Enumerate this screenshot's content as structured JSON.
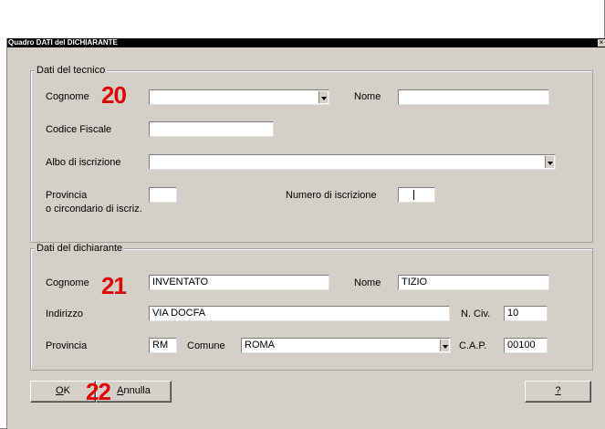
{
  "window": {
    "title": "Quadro DATI del DICHIARANTE",
    "close": "×"
  },
  "tecnico": {
    "legend": "Dati del tecnico",
    "cognome_label": "Cognome",
    "cognome_value": "",
    "nome_label": "Nome",
    "nome_value": "",
    "codice_fiscale_label": "Codice Fiscale",
    "codice_fiscale_value": "",
    "albo_label": "Albo di iscrizione",
    "albo_value": "",
    "provincia_label": "Provincia",
    "provincia_label2": "o circondario di iscriz.",
    "provincia_value": "",
    "numero_label": "Numero di iscrizione",
    "numero_value": ""
  },
  "dichiarante": {
    "legend": "Dati del dichiarante",
    "cognome_label": "Cognome",
    "cognome_value": "INVENTATO",
    "nome_label": "Nome",
    "nome_value": "TIZIO",
    "indirizzo_label": "Indirizzo",
    "indirizzo_value": "VIA DOCFA",
    "nciv_label": "N. Civ.",
    "nciv_value": "10",
    "provincia_label": "Provincia",
    "provincia_value": "RM",
    "comune_label": "Comune",
    "comune_value": "ROMA",
    "cap_label": "C.A.P.",
    "cap_value": "00100"
  },
  "buttons": {
    "ok_underlined": "O",
    "ok_rest": "K",
    "annulla_underlined": "A",
    "annulla_rest": "nnulla",
    "help": "?"
  },
  "markers": {
    "m20": "20",
    "m21": "21",
    "m22": "22"
  }
}
